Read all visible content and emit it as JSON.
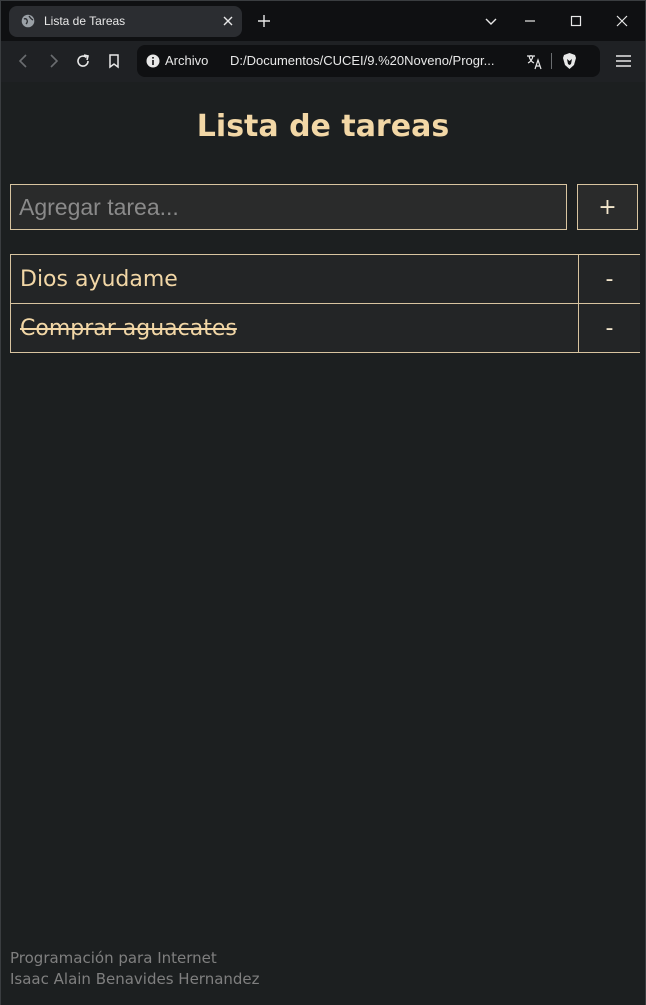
{
  "browser": {
    "tab_title": "Lista de Tareas",
    "omnibox_scheme": "Archivo",
    "omnibox_url": "D:/Documentos/CUCEI/9.%20Noveno/Progr..."
  },
  "page": {
    "title": "Lista de tareas",
    "input_placeholder": "Agregar tarea...",
    "add_label": "+",
    "tasks": [
      {
        "text": "Dios ayudame",
        "done": false,
        "remove_label": "-"
      },
      {
        "text": "Comprar aguacates",
        "done": true,
        "remove_label": "-"
      }
    ],
    "footer": {
      "line1": "Programación para Internet",
      "line2": "Isaac Alain Benavides Hernandez"
    }
  },
  "colors": {
    "accent": "#f2d7a6",
    "border": "#d8c4a0",
    "background": "#1c1f20"
  }
}
